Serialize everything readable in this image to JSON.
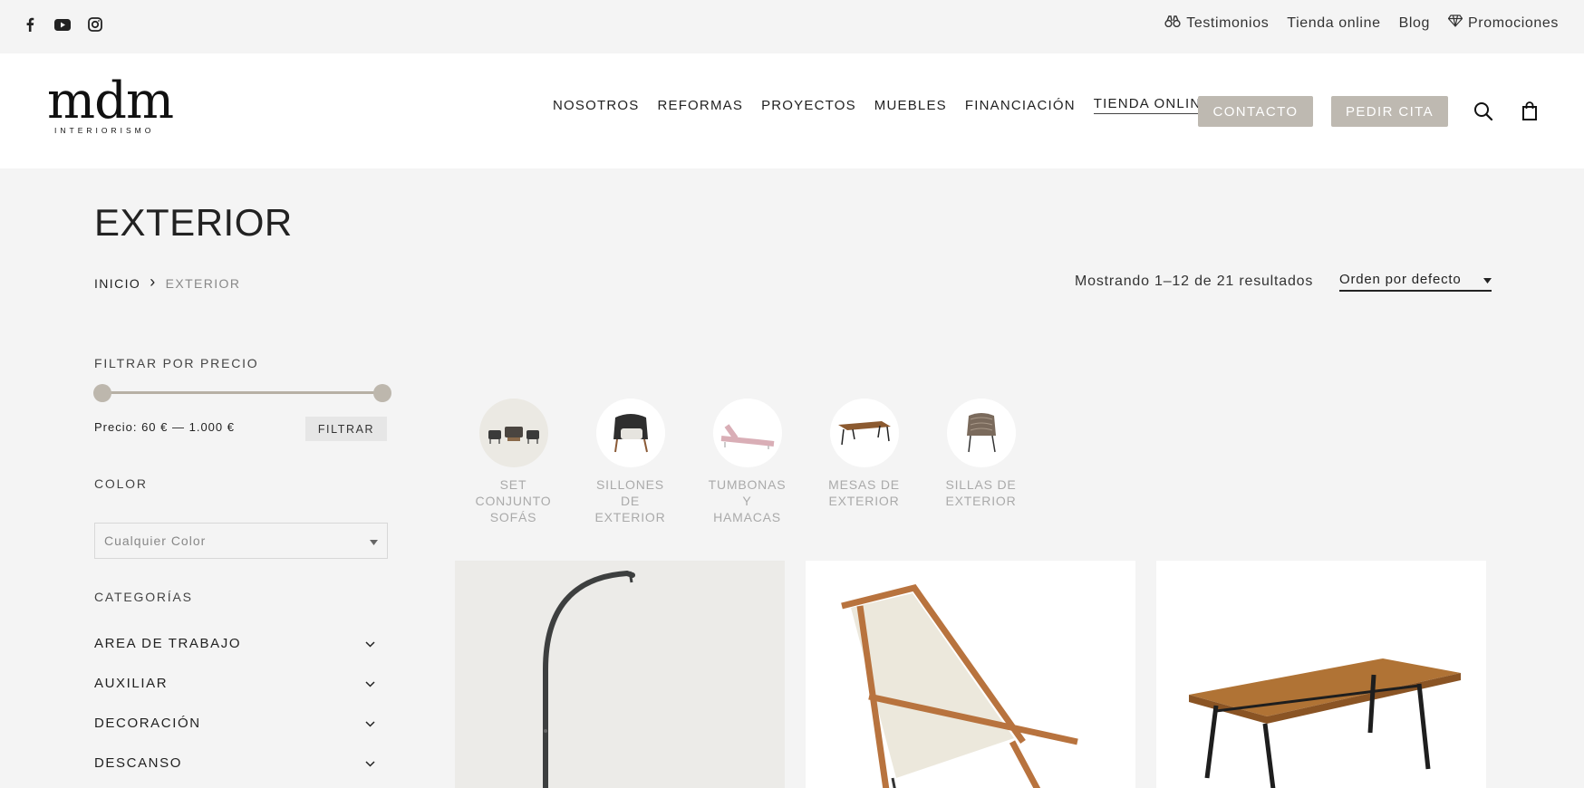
{
  "topbar": {
    "social": [
      "facebook-icon",
      "youtube-icon",
      "instagram-icon"
    ],
    "links": [
      {
        "label": "Testimonios",
        "icon": "binoculars-icon"
      },
      {
        "label": "Tienda online",
        "icon": ""
      },
      {
        "label": "Blog",
        "icon": ""
      },
      {
        "label": "Promociones",
        "icon": "diamond-icon"
      }
    ]
  },
  "header": {
    "logo_main": "mdm",
    "logo_sub": "INTERIORISMO",
    "nav": [
      "NOSOTROS",
      "REFORMAS",
      "PROYECTOS",
      "MUEBLES",
      "FINANCIACIÓN",
      "TIENDA ONLINE"
    ],
    "contact_label": "CONTACTO",
    "appointment_label": "PEDIR CITA",
    "accent": "#beb9b1"
  },
  "page": {
    "title": "EXTERIOR",
    "breadcrumb": {
      "home": "INICIO",
      "separator": "›",
      "current": "EXTERIOR"
    },
    "results_text": "Mostrando 1–12 de 21 resultados",
    "orderby": "Orden por defecto"
  },
  "sidebar": {
    "price_heading": "FILTRAR POR PRECIO",
    "price_text": "Precio: 60 € — 1.000 €",
    "filter_label": "FILTRAR",
    "color_heading": "COLOR",
    "color_placeholder": "Cualquier Color",
    "categories_heading": "CATEGORÍAS",
    "categories": [
      "AREA DE TRABAJO",
      "AUXILIAR",
      "DECORACIÓN",
      "DESCANSO"
    ]
  },
  "subcategories": [
    {
      "lines": [
        "SET",
        "CONJUNTO",
        "SOFÁS"
      ],
      "icon": "sofa-set-icon"
    },
    {
      "lines": [
        "SILLONES",
        "DE",
        "EXTERIOR"
      ],
      "icon": "armchair-icon"
    },
    {
      "lines": [
        "TUMBONAS",
        "Y",
        "HAMACAS"
      ],
      "icon": "lounger-icon"
    },
    {
      "lines": [
        "MESAS DE",
        "EXTERIOR"
      ],
      "icon": "table-icon"
    },
    {
      "lines": [
        "SILLAS DE",
        "EXTERIOR"
      ],
      "icon": "chair-icon"
    }
  ],
  "products": [
    {
      "icon": "hanging-chair-icon"
    },
    {
      "icon": "deck-chair-icon"
    },
    {
      "icon": "garden-table-icon"
    }
  ]
}
